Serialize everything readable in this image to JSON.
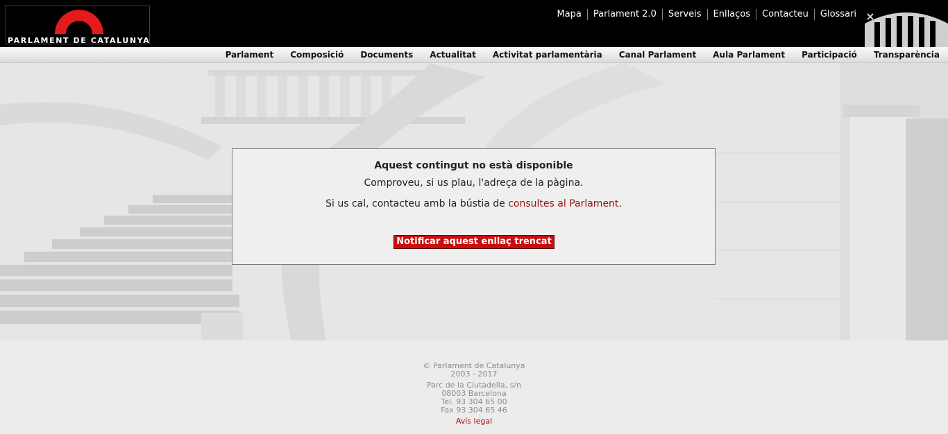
{
  "brand": {
    "name": "PARLAMENT DE CATALUNYA",
    "accent": "#e31b1b"
  },
  "utility_nav": [
    "Mapa",
    "Parlament 2.0",
    "Serveis",
    "Enllaços",
    "Contacteu",
    "Glossari"
  ],
  "main_nav": [
    "Parlament",
    "Composició",
    "Documents",
    "Actualitat",
    "Activitat parlamentària",
    "Canal Parlament",
    "Aula Parlament",
    "Participació",
    "Transparència"
  ],
  "message": {
    "title": "Aquest contingut no està disponible",
    "line1": "Comproveu, si us plau, l'adreça de la pàgina.",
    "line2_prefix": "Si us cal, contacteu amb la bústia de ",
    "line2_link": "consultes al Parlament",
    "line2_suffix": ".",
    "button": "Notificar aquest enllaç trencat"
  },
  "footer": {
    "copyright": "© Parlament de Catalunya",
    "years": "2003 - 2017",
    "address": "Parc de la Ciutadella, s/n",
    "city": "08003 Barcelona",
    "tel": "Tel. 93 304 65 00",
    "fax": "Fax 93 304 65 46",
    "legal": "Avís legal"
  }
}
